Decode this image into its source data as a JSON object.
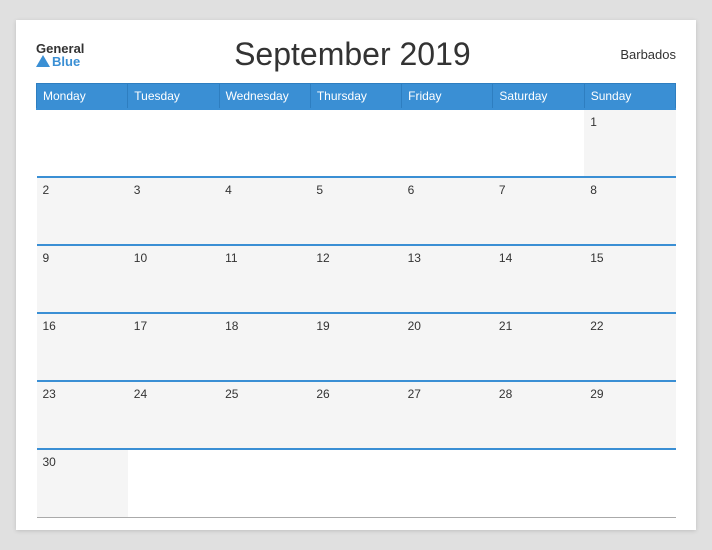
{
  "header": {
    "logo_general": "General",
    "logo_blue": "Blue",
    "title": "September 2019",
    "country": "Barbados"
  },
  "columns": [
    "Monday",
    "Tuesday",
    "Wednesday",
    "Thursday",
    "Friday",
    "Saturday",
    "Sunday"
  ],
  "weeks": [
    [
      null,
      null,
      null,
      null,
      null,
      null,
      1
    ],
    [
      2,
      3,
      4,
      5,
      6,
      7,
      8
    ],
    [
      9,
      10,
      11,
      12,
      13,
      14,
      15
    ],
    [
      16,
      17,
      18,
      19,
      20,
      21,
      22
    ],
    [
      23,
      24,
      25,
      26,
      27,
      28,
      29
    ],
    [
      30,
      null,
      null,
      null,
      null,
      null,
      null
    ]
  ]
}
